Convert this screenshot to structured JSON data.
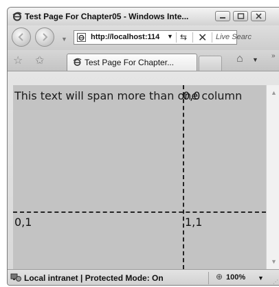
{
  "window": {
    "title": "Test Page For Chapter05 - Windows Inte...",
    "icons": {
      "app": "ie-logo-icon",
      "minimize": "minimize-icon",
      "maximize": "maximize-icon",
      "close": "close-icon"
    }
  },
  "navigation": {
    "back_icon": "back-arrow-icon",
    "forward_icon": "forward-arrow-icon",
    "address": "http://localhost:114",
    "search_placeholder": "Live Searc",
    "refresh_icon": "refresh-icon",
    "stop_icon": "stop-icon"
  },
  "tabs": {
    "favorites_icon": "favorites-star-icon",
    "add_favorites_icon": "add-favorites-icon",
    "items": [
      {
        "label": "Test Page For Chapter..."
      }
    ],
    "home_icon": "home-icon",
    "more_label": "»"
  },
  "content": {
    "spanning_text": "This text will span more than one column",
    "cells": {
      "r0c1": "0,0",
      "r1c0": "0,1",
      "r1c1": "1,1"
    },
    "background": "#c3c3c3"
  },
  "status": {
    "zone": "Local intranet | Protected Mode: On",
    "zoom": "100%"
  }
}
